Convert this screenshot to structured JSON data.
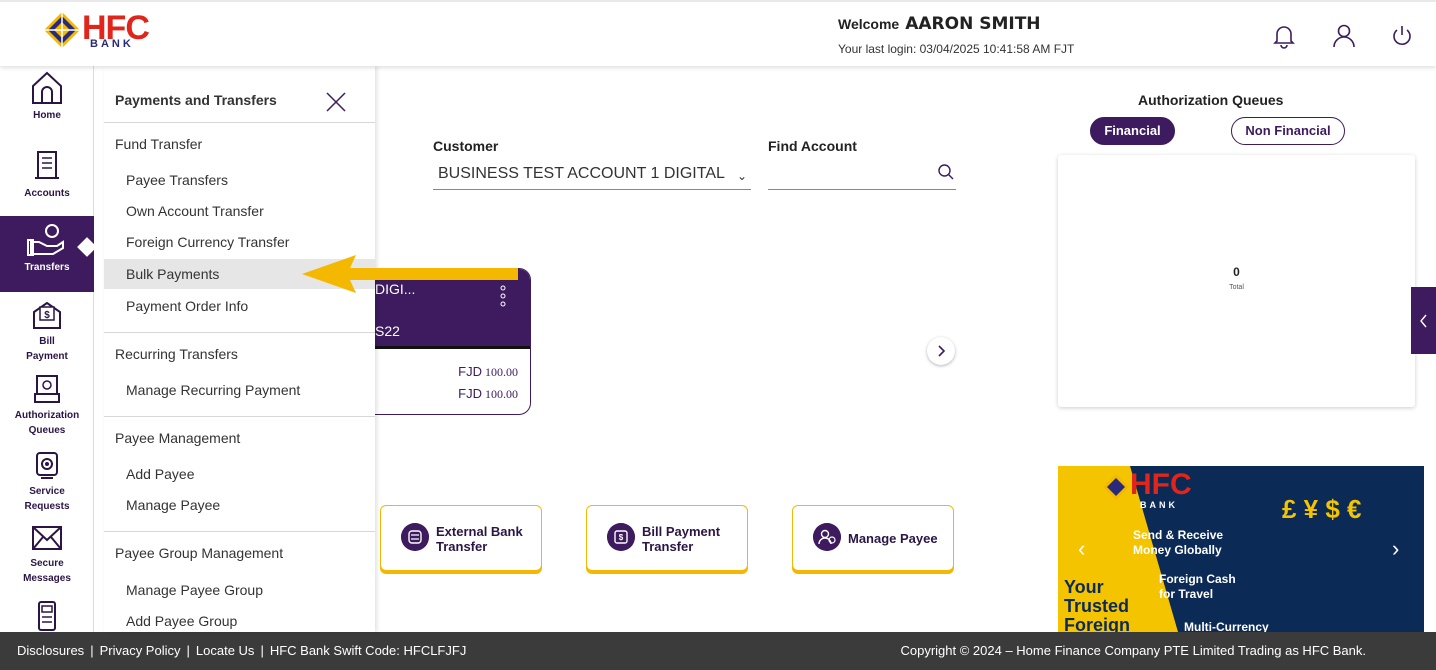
{
  "header": {
    "logo_text": "HFC",
    "logo_sub": "BANK",
    "welcome_label": "Welcome",
    "user_name": "AARON SMITH",
    "last_login": "Your last login: 03/04/2025 10:41:58 AM FJT"
  },
  "leftnav": {
    "items": [
      {
        "label": "Home"
      },
      {
        "label": "Accounts"
      },
      {
        "label": "Transfers"
      },
      {
        "label": "Bill",
        "label2": "Payment"
      },
      {
        "label": "Authorization",
        "label2": "Queues"
      },
      {
        "label": "Service",
        "label2": "Requests"
      },
      {
        "label": "Secure",
        "label2": "Messages"
      }
    ]
  },
  "submenu": {
    "title": "Payments and Transfers",
    "groups": [
      {
        "label": "Fund Transfer",
        "items": [
          "Payee Transfers",
          "Own Account Transfer",
          "Foreign Currency Transfer",
          "Bulk Payments",
          "Payment Order Info"
        ]
      },
      {
        "label": "Recurring Transfers",
        "items": [
          "Manage Recurring Payment"
        ]
      },
      {
        "label": "Payee Management",
        "items": [
          "Add Payee",
          "Manage Payee"
        ]
      },
      {
        "label": "Payee Group Management",
        "items": [
          "Manage Payee Group",
          "Add Payee Group"
        ]
      }
    ],
    "highlighted": "Bulk Payments"
  },
  "main": {
    "customer_label": "Customer",
    "customer_value": "BUSINESS TEST ACCOUNT 1 DIGITAL",
    "find_label": "Find Account",
    "find_placeholder": "",
    "card": {
      "name": "DIGI...",
      "number": "S22",
      "amount1_cur": "FJD",
      "amount1": "100.00",
      "amount2_cur": "FJD",
      "amount2": "100.00"
    },
    "quick_actions": [
      {
        "line1": "External Bank",
        "line2": "Transfer"
      },
      {
        "line1": "Bill Payment",
        "line2": "Transfer"
      },
      {
        "line1": "Manage Payee",
        "line2": ""
      }
    ]
  },
  "auth": {
    "title": "Authorization Queues",
    "tab_financial": "Financial",
    "tab_non_financial": "Non Financial",
    "count": "0",
    "count_label": "Total"
  },
  "banner": {
    "line1": "Send & Receive",
    "line2": "Money Globally",
    "line3": "Foreign Cash",
    "line4": "for Travel",
    "line5": "Multi-Currency",
    "trusted1": "Your",
    "trusted2": "Trusted",
    "trusted3": "Foreign",
    "currencies": "£ ¥ $ €"
  },
  "footer": {
    "disclosures": "Disclosures",
    "privacy": "Privacy Policy",
    "locate": "Locate Us",
    "swift": "HFC Bank Swift Code: HFCLFJFJ",
    "copyright": "Copyright © 2024 – Home Finance Company PTE Limited Trading as HFC Bank."
  },
  "colors": {
    "primary": "#3d1b5e",
    "accent": "#f5b800",
    "brand_red": "#e1251b",
    "footer_bg": "#3b3b3b"
  }
}
